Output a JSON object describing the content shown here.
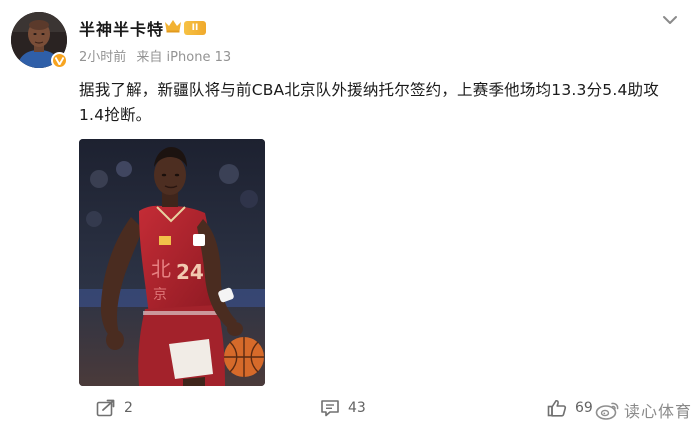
{
  "user": {
    "name": "半神半卡特",
    "level_badge": "II",
    "avatar": "user-avatar-portrait"
  },
  "meta": {
    "time": "2小时前",
    "source": "来自 iPhone 13"
  },
  "post": {
    "text": "据我了解，新疆队将与前CBA北京队外援纳托尔签约，上赛季他场均13.3分5.4助攻1.4抢断。",
    "photo": "basketball-player-dribbling-photo",
    "jersey_number": "24"
  },
  "actions": {
    "repost_count": "2",
    "comment_count": "43",
    "like_count": "69"
  },
  "watermark": {
    "text": "读心体育"
  },
  "icons": {
    "more": "chevron-down-icon",
    "repost": "share-icon",
    "comment": "comment-icon",
    "like": "thumbs-up-icon",
    "verified": "verified-v-icon",
    "crown": "crown-icon",
    "watermark_logo": "weibo-logo-icon"
  },
  "colors": {
    "verified_badge": "#f7a420",
    "meta_text": "#939393",
    "jersey_red": "#b1232d",
    "crown_gold": "#f2b233"
  }
}
